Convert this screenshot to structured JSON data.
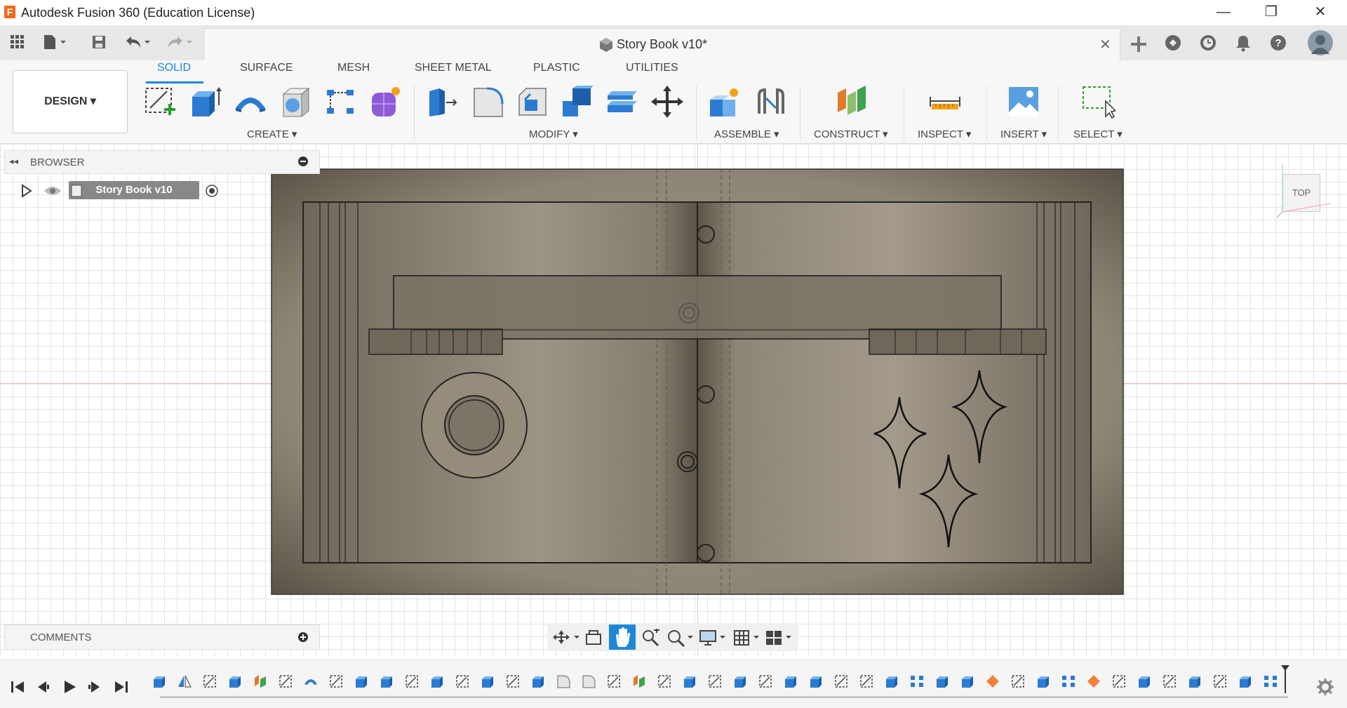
{
  "window": {
    "app_title": "Autodesk Fusion 360 (Education License)",
    "logo_letter": "F",
    "controls": [
      "minimize-icon",
      "restore-icon",
      "close-icon"
    ]
  },
  "document": {
    "title": "Story Book v10*",
    "close_symbol": "✕"
  },
  "quick_access": [
    "grid-apps-icon",
    "file-menu-icon",
    "save-icon",
    "undo-icon",
    "redo-icon"
  ],
  "right_header_icons": [
    "new-tab-icon",
    "extensions-icon",
    "job-status-icon",
    "notifications-icon",
    "help-icon",
    "avatar"
  ],
  "workspace": {
    "label": "DESIGN ▾"
  },
  "tabs": [
    {
      "label": "SOLID",
      "active": true
    },
    {
      "label": "SURFACE",
      "active": false
    },
    {
      "label": "MESH",
      "active": false
    },
    {
      "label": "SHEET METAL",
      "active": false
    },
    {
      "label": "PLASTIC",
      "active": false
    },
    {
      "label": "UTILITIES",
      "active": false
    }
  ],
  "groups": {
    "create": "CREATE ▾",
    "modify": "MODIFY ▾",
    "assemble": "ASSEMBLE ▾",
    "construct": "CONSTRUCT ▾",
    "inspect": "INSPECT ▾",
    "insert": "INSERT ▾",
    "select": "SELECT ▾"
  },
  "browser": {
    "label": "BROWSER",
    "item": "Story Book v10"
  },
  "comments": {
    "label": "COMMENTS"
  },
  "viewcube": {
    "face": "TOP"
  },
  "colors": {
    "accent": "#1e88d8",
    "model_base": "#8f8677",
    "model_dark": "#5e574d"
  }
}
